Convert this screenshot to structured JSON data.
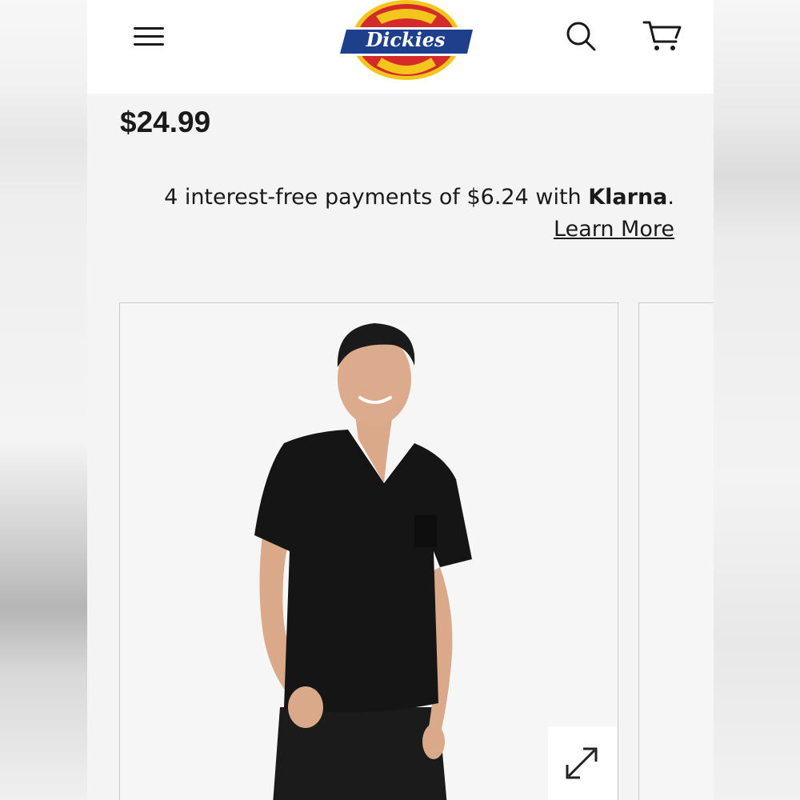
{
  "header": {
    "brand": "Dickies",
    "menu_icon": "hamburger-menu-icon",
    "search_icon": "search-icon",
    "cart_icon": "shopping-cart-icon"
  },
  "product": {
    "price": "$24.99"
  },
  "klarna": {
    "text_prefix": "4 interest-free payments of $6.24 with ",
    "brand": "Klarna",
    "suffix": ".",
    "link": "Learn More"
  },
  "gallery": {
    "expand_icon": "expand-arrows-icon"
  },
  "colors": {
    "logo_blue": "#1e3f8c",
    "logo_red": "#d42a2a",
    "logo_yellow": "#f4c61c"
  }
}
